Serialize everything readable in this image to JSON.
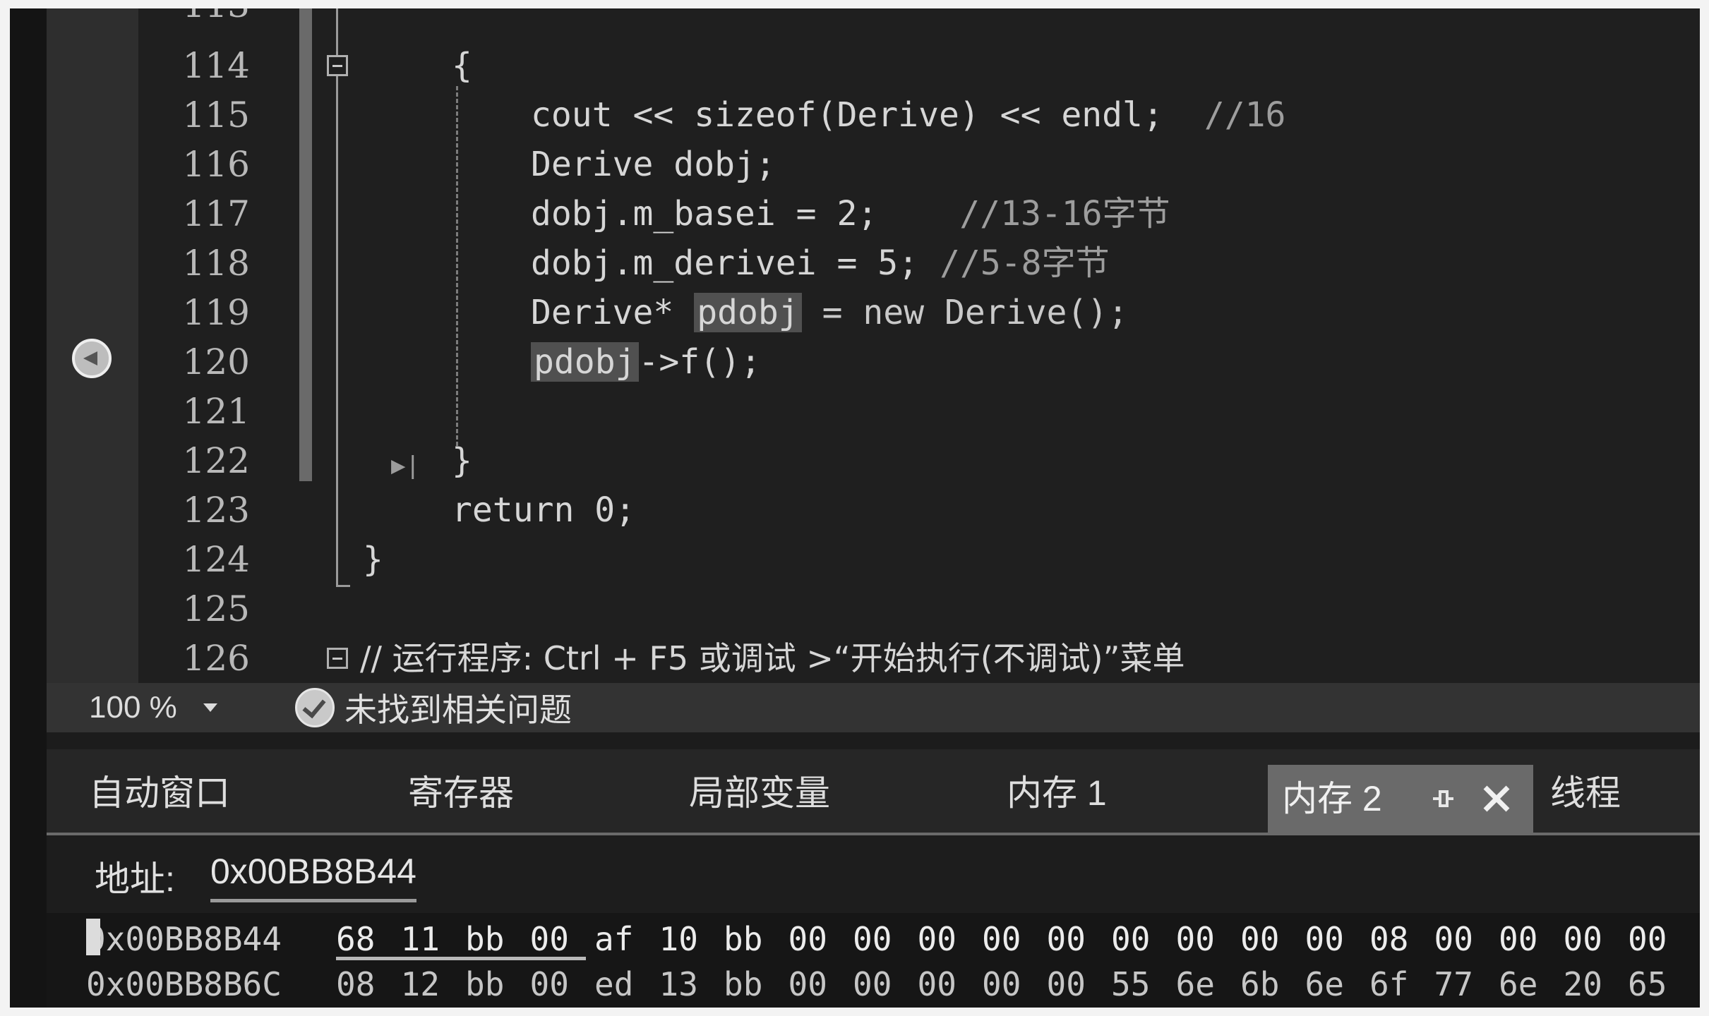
{
  "editor": {
    "partial_top_line": "113",
    "lines": [
      {
        "no": "114",
        "code": "{"
      },
      {
        "no": "115",
        "code": "cout << sizeof(Derive) << endl;  //16"
      },
      {
        "no": "116",
        "code": "Derive dobj;"
      },
      {
        "no": "117",
        "code": "dobj.m_basei = 2;   //13-16字节"
      },
      {
        "no": "118",
        "code": "dobj.m_derivei = 5; //5-8字节"
      },
      {
        "no": "119",
        "code": "Derive* pdobj = new Derive();"
      },
      {
        "no": "120",
        "code": "pdobj->f();"
      },
      {
        "no": "121",
        "code": ""
      },
      {
        "no": "122",
        "code": "}"
      },
      {
        "no": "123",
        "code": "return 0;"
      },
      {
        "no": "124",
        "code": "}"
      },
      {
        "no": "125",
        "code": ""
      },
      {
        "no": "126",
        "code": "// 运行程序: Ctrl + F5 或调试 >“开始执行(不调试)”菜单"
      }
    ],
    "l115_a": "cout << sizeof(Derive) << endl;",
    "l115_b": "//16",
    "l117_a": "dobj.m_basei = 2;",
    "l117_b": "//13-16字节",
    "l118_a": "dobj.m_derivei = 5;",
    "l118_b": "//5-8字节",
    "l119_a": "Derive*",
    "l119_hl": "pdobj",
    "l119_b": "= new Derive();",
    "l120_hl": "pdobj",
    "l120_b": "->f();",
    "step_marker": "▶|",
    "current_line": "120"
  },
  "status": {
    "zoom": "100 %",
    "message": "未找到相关问题"
  },
  "tabs": {
    "items": [
      "自动窗口",
      "寄存器",
      "局部变量",
      "内存 1",
      "内存 2",
      "线程"
    ],
    "active": "内存 2",
    "pin_icon": "pin-icon",
    "close_icon": "close-icon"
  },
  "memory": {
    "address_label": "地址:",
    "address_value": "0x00BB8B44",
    "rows": [
      {
        "address": "0x00BB8B44",
        "bytes": [
          "68",
          "11",
          "bb",
          "00",
          "af",
          "10",
          "bb",
          "00",
          "00",
          "00",
          "00",
          "00",
          "00",
          "00",
          "00",
          "00",
          "08",
          "00",
          "00",
          "00",
          "00"
        ]
      },
      {
        "address": "0x00BB8B6C",
        "bytes": [
          "08",
          "12",
          "bb",
          "00",
          "ed",
          "13",
          "bb",
          "00",
          "00",
          "00",
          "00",
          "00",
          "55",
          "6e",
          "6b",
          "6e",
          "6f",
          "77",
          "6e",
          "20",
          "65"
        ]
      }
    ]
  },
  "colors": {
    "editor_bg": "#1f1f1f",
    "margin_bg": "#2e2e2e",
    "highlight": "#505050",
    "active_tab": "#6a6a6a"
  }
}
